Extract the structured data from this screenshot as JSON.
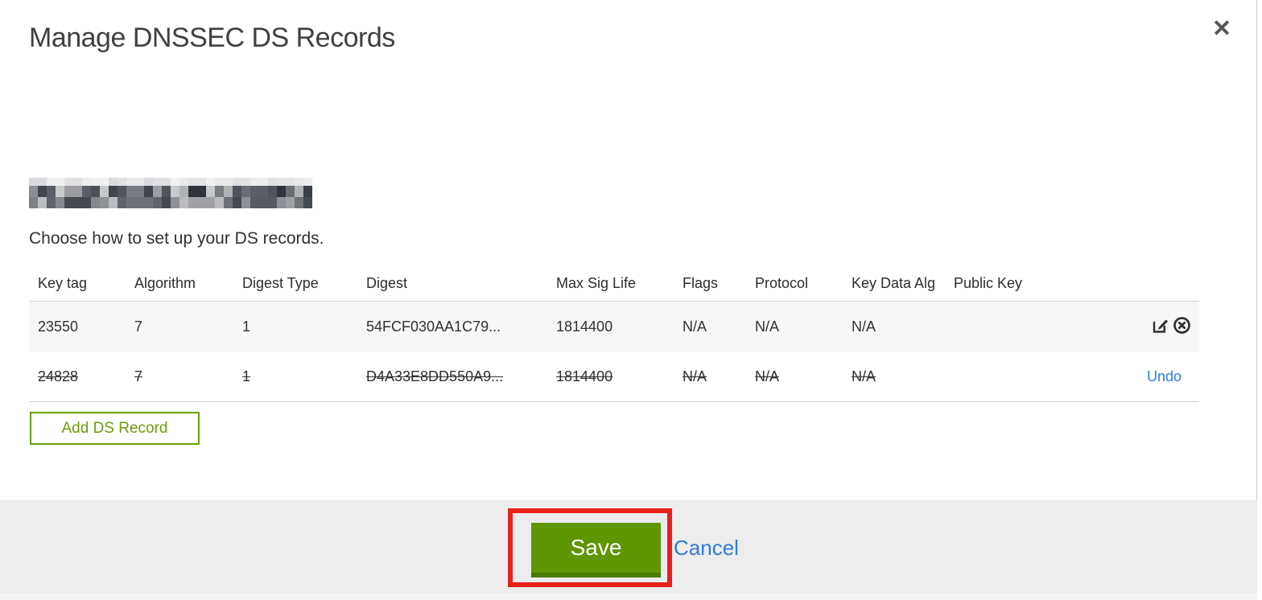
{
  "modal": {
    "title": "Manage DNSSEC DS Records",
    "close_glyph": "✕",
    "subtitle": "Choose how to set up your DS records.",
    "domain_redacted": true
  },
  "table": {
    "columns": {
      "key_tag": "Key tag",
      "algorithm": "Algorithm",
      "digest_type": "Digest Type",
      "digest": "Digest",
      "max_sig_life": "Max Sig Life",
      "flags": "Flags",
      "protocol": "Protocol",
      "key_data_alg": "Key Data Alg",
      "public_key": "Public Key"
    },
    "rows": [
      {
        "key_tag": "23550",
        "algorithm": "7",
        "digest_type": "1",
        "digest": "54FCF030AA1C79...",
        "max_sig_life": "1814400",
        "flags": "N/A",
        "protocol": "N/A",
        "key_data_alg": "N/A",
        "public_key": "",
        "deleted": false
      },
      {
        "key_tag": "24828",
        "algorithm": "7",
        "digest_type": "1",
        "digest": "D4A33E8DD550A9...",
        "max_sig_life": "1814400",
        "flags": "N/A",
        "protocol": "N/A",
        "key_data_alg": "N/A",
        "public_key": "",
        "deleted": true,
        "undo_label": "Undo"
      }
    ]
  },
  "buttons": {
    "add_ds_record": "Add DS Record",
    "save": "Save",
    "cancel": "Cancel"
  },
  "colors": {
    "accent_green_outline": "#699e07",
    "save_green": "#609504",
    "link_blue": "#2e7bdf",
    "annotation_red": "#e8211d",
    "footer_gray": "#ededed",
    "row_stripe_gray": "#f7f7f7"
  }
}
